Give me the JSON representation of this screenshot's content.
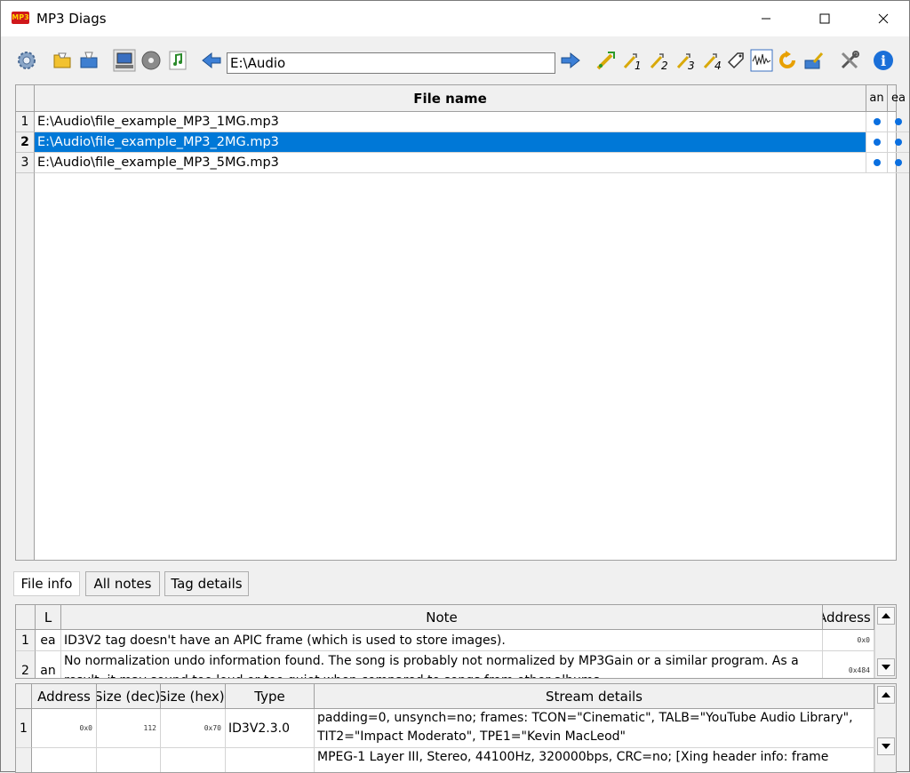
{
  "window": {
    "title": "MP3 Diags",
    "app_icon_text": "MP3",
    "controls": [
      "minimize",
      "maximize",
      "close"
    ]
  },
  "toolbar": {
    "path": "E:\\Audio",
    "icons_left": [
      "settings-gear-icon",
      "open-folder-icon",
      "save-folder-icon",
      "computer-icon",
      "cd-icon",
      "music-note-icon",
      "back-arrow-icon"
    ],
    "icons_right": [
      "forward-arrow-icon",
      "transform-all-icon",
      "transform-1-icon",
      "transform-2-icon",
      "transform-3-icon",
      "transform-4-icon",
      "tag-editor-icon",
      "normalize-icon",
      "reload-icon",
      "rename-icon",
      "tools-icon",
      "about-icon"
    ],
    "transform_labels": [
      "1",
      "2",
      "3",
      "4"
    ],
    "about_icon_glyph": "i"
  },
  "files": {
    "header": {
      "name": "File name",
      "col_an": "an",
      "col_ea": "ea"
    },
    "rows": [
      {
        "num": "1",
        "name": "E:\\Audio\\file_example_MP3_1MG.mp3",
        "selected": false
      },
      {
        "num": "2",
        "name": "E:\\Audio\\file_example_MP3_2MG.mp3",
        "selected": true
      },
      {
        "num": "3",
        "name": "E:\\Audio\\file_example_MP3_5MG.mp3",
        "selected": false
      }
    ]
  },
  "tabs": [
    {
      "label": "File info",
      "active": true
    },
    {
      "label": "All notes",
      "active": false
    },
    {
      "label": "Tag details",
      "active": false
    }
  ],
  "notes": {
    "header": {
      "level": "L",
      "note": "Note",
      "address": "Address"
    },
    "rows": [
      {
        "num": "1",
        "level": "ea",
        "note": "ID3V2 tag doesn't have an APIC frame (which is used to store images).",
        "address": "0x0"
      },
      {
        "num": "2",
        "level": "an",
        "note": "No normalization undo information found. The song is probably not normalized by MP3Gain or a similar program. As a result, it may sound too loud or too quiet when compared to songs from other albums.",
        "address": "0x484"
      }
    ]
  },
  "streams": {
    "header": {
      "address": "Address",
      "size_dec": "Size (dec)",
      "size_hex": "Size (hex)",
      "type": "Type",
      "details": "Stream details"
    },
    "rows": [
      {
        "num": "1",
        "address": "0x0",
        "size_dec": "112",
        "size_hex": "0x70",
        "type": "ID3V2.3.0",
        "details": "padding=0, unsynch=no; frames: TCON=\"Cinematic\", TALB=\"YouTube Audio Library\", TIT2=\"Impact Moderato\", TPE1=\"Kevin MacLeod\""
      },
      {
        "num": "",
        "address": "",
        "size_dec": "",
        "size_hex": "",
        "type": "",
        "details": "MPEG-1 Layer III, Stereo, 44100Hz, 320000bps, CRC=no; [Xing header info: frame"
      }
    ]
  }
}
